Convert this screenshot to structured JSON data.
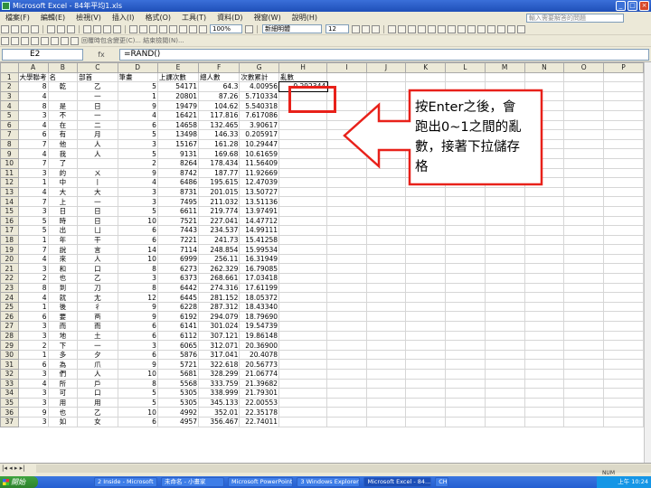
{
  "window": {
    "title": "Microsoft Excel - 84年平均1.xls",
    "controls": [
      "_",
      "□",
      "×"
    ]
  },
  "menubar": {
    "items": [
      "檔案(F)",
      "編輯(E)",
      "檢視(V)",
      "插入(I)",
      "格式(O)",
      "工具(T)",
      "資料(D)",
      "視窗(W)",
      "說明(H)"
    ],
    "help_placeholder": "輸入需要解答的問題"
  },
  "toolbar": {
    "font_size": "100%",
    "font_name": "新細明體",
    "point_size": "12",
    "review_text": "回覆時包含變更(C)... 結束檢閱(N)..."
  },
  "formula_bar": {
    "name_box": "E2",
    "fx": "fx",
    "formula": "=RAND()"
  },
  "sheet": {
    "columns": [
      "",
      "A",
      "B",
      "C",
      "D",
      "E",
      "F",
      "G",
      "H",
      "I",
      "J",
      "K",
      "L",
      "M",
      "N",
      "O",
      "P"
    ],
    "header_row": [
      "大學聯考",
      "名",
      "部首",
      "筆畫",
      "上課次數",
      "總人數",
      "次數累計",
      "亂數"
    ],
    "rows": [
      [
        "2",
        "8",
        "乾",
        "乙",
        "5",
        "54171",
        "64.3",
        "4.00956",
        "0.292344"
      ],
      [
        "3",
        "4",
        "",
        "一",
        "1",
        "20801",
        "87.26",
        "5.710334",
        ""
      ],
      [
        "4",
        "8",
        "是",
        "日",
        "9",
        "19479",
        "104.62",
        "5.540318",
        ""
      ],
      [
        "5",
        "3",
        "不",
        "一",
        "4",
        "16421",
        "117.816",
        "7.617086",
        ""
      ],
      [
        "6",
        "4",
        "在",
        "二",
        "6",
        "14658",
        "132.465",
        "3.90617",
        ""
      ],
      [
        "7",
        "6",
        "有",
        "月",
        "5",
        "13498",
        "146.33",
        "0.205917",
        ""
      ],
      [
        "8",
        "7",
        "他",
        "人",
        "3",
        "15167",
        "161.28",
        "10.29447",
        ""
      ],
      [
        "9",
        "4",
        "我",
        "人",
        "5",
        "9131",
        "169.68",
        "10.61659",
        ""
      ],
      [
        "10",
        "7",
        "了",
        "",
        "2",
        "8264",
        "178.434",
        "11.56409",
        ""
      ],
      [
        "11",
        "3",
        "的",
        "ㄨ",
        "9",
        "8742",
        "187.77",
        "11.92669",
        ""
      ],
      [
        "12",
        "1",
        "中",
        "丨",
        "4",
        "6486",
        "195.615",
        "12.47039",
        ""
      ],
      [
        "13",
        "4",
        "大",
        "大",
        "3",
        "8731",
        "201.015",
        "13.50727",
        ""
      ],
      [
        "14",
        "7",
        "上",
        "一",
        "3",
        "7495",
        "211.032",
        "13.51136",
        ""
      ],
      [
        "15",
        "3",
        "日",
        "日",
        "5",
        "6611",
        "219.774",
        "13.97491",
        ""
      ],
      [
        "16",
        "5",
        "時",
        "日",
        "10",
        "7521",
        "227.041",
        "14.47712",
        ""
      ],
      [
        "17",
        "5",
        "出",
        "凵",
        "6",
        "7443",
        "234.537",
        "14.99111",
        ""
      ],
      [
        "18",
        "1",
        "年",
        "干",
        "6",
        "7221",
        "241.73",
        "15.41258",
        ""
      ],
      [
        "19",
        "7",
        "說",
        "言",
        "14",
        "7114",
        "248.854",
        "15.99534",
        ""
      ],
      [
        "20",
        "4",
        "來",
        "人",
        "10",
        "6999",
        "256.11",
        "16.31949",
        ""
      ],
      [
        "21",
        "3",
        "和",
        "口",
        "8",
        "6273",
        "262.329",
        "16.79085",
        ""
      ],
      [
        "22",
        "2",
        "也",
        "乙",
        "3",
        "6373",
        "268.661",
        "17.03418",
        ""
      ],
      [
        "23",
        "8",
        "到",
        "刀",
        "8",
        "6442",
        "274.316",
        "17.61199",
        ""
      ],
      [
        "24",
        "4",
        "就",
        "尢",
        "12",
        "6445",
        "281.152",
        "18.05372",
        ""
      ],
      [
        "25",
        "1",
        "後",
        "彳",
        "9",
        "6228",
        "287.312",
        "18.43340",
        ""
      ],
      [
        "26",
        "6",
        "要",
        "襾",
        "9",
        "6192",
        "294.079",
        "18.79690",
        ""
      ],
      [
        "27",
        "3",
        "而",
        "而",
        "6",
        "6141",
        "301.024",
        "19.54739",
        ""
      ],
      [
        "28",
        "3",
        "地",
        "土",
        "6",
        "6112",
        "307.121",
        "19.86148",
        ""
      ],
      [
        "29",
        "2",
        "下",
        "一",
        "3",
        "6065",
        "312.071",
        "20.36900",
        ""
      ],
      [
        "30",
        "1",
        "多",
        "夕",
        "6",
        "5876",
        "317.041",
        "20.4078",
        ""
      ],
      [
        "31",
        "6",
        "為",
        "爪",
        "9",
        "5721",
        "322.618",
        "20.56773",
        ""
      ],
      [
        "32",
        "3",
        "們",
        "人",
        "10",
        "5681",
        "328.299",
        "21.06774",
        ""
      ],
      [
        "33",
        "4",
        "所",
        "戶",
        "8",
        "5568",
        "333.759",
        "21.39682",
        ""
      ],
      [
        "34",
        "3",
        "可",
        "口",
        "5",
        "5305",
        "338.999",
        "21.79301",
        ""
      ],
      [
        "35",
        "3",
        "用",
        "用",
        "5",
        "5305",
        "345.133",
        "22.00553",
        ""
      ],
      [
        "36",
        "9",
        "也",
        "乙",
        "10",
        "4992",
        "352.01",
        "22.35178",
        ""
      ],
      [
        "37",
        "3",
        "如",
        "女",
        "6",
        "4957",
        "356.467",
        "22.74011",
        ""
      ]
    ]
  },
  "callout": {
    "text": "按Enter之後，會跑出0~1之間的亂數，接著下拉儲存格"
  },
  "sheet_tabs": {
    "nav": "|◂ ◂ ▸ ▸|",
    "status_right": "NUM"
  },
  "taskbar": {
    "start_label": "開始",
    "tasks": [
      "2 Inside - Microsoft",
      "未命名 - 小畫家",
      "Microsoft PowerPoint",
      "3 Windows Explorer",
      "Microsoft Excel - 84...",
      "CH"
    ],
    "clock": "上午 10:24"
  },
  "colors": {
    "highlight_border": "#e8211a",
    "titlebar": "#1f4fb8",
    "chrome": "#ece9d8"
  }
}
